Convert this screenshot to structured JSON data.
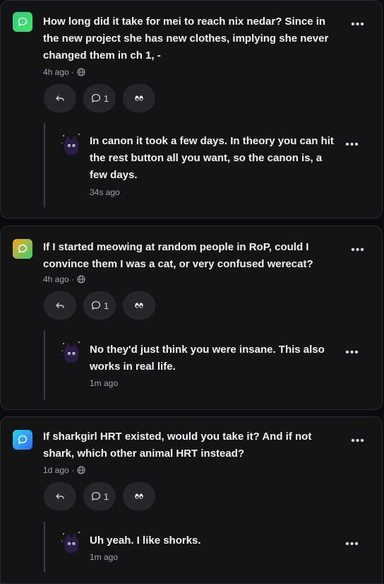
{
  "posts": [
    {
      "question": "How long did it take for mei to reach nix nedar? Since in the new project she has new clothes, implying she never changed them in ch 1, -",
      "time": "4h ago ·",
      "comment_count": "1",
      "avatar_gradient": [
        "#31d07a",
        "#3fe36b"
      ],
      "reply": {
        "text": "In canon it took a few days. In theory you can hit the rest button all you want, so the canon is, a few days.",
        "time": "34s ago"
      }
    },
    {
      "question": "If I started meowing at random people in RoP, could I convince them I was a cat, or very confused werecat?",
      "time": "4h ago ·",
      "comment_count": "1",
      "avatar_gradient": [
        "#f5a623",
        "#35d16c"
      ],
      "reply": {
        "text": "No they'd just think you were insane. This also works in real life.",
        "time": "1m ago"
      }
    },
    {
      "question": "If sharkgirl HRT existed, would you take it? And if not shark, which other animal HRT instead?",
      "time": "1d ago ·",
      "comment_count": "1",
      "avatar_gradient": [
        "#2bd4e8",
        "#2f6bff"
      ],
      "reply": {
        "text": "Uh yeah. I like shorks.",
        "time": "1m ago"
      }
    }
  ],
  "icons": {
    "avatar": "speech-bubble-icon",
    "visibility": "globe-icon",
    "more": "more-horizontal-icon",
    "reply": "reply-arrow-icon",
    "comments": "comment-bubble-icon",
    "react": "eyes-icon"
  },
  "colors": {
    "background": "#0b0b0d",
    "card": "#141417",
    "pill": "#26262b",
    "muted_text": "#a3a3aa"
  }
}
